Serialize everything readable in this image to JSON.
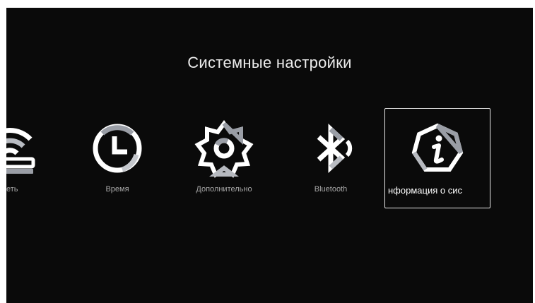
{
  "page": {
    "title": "Системные настройки"
  },
  "menu": {
    "items": [
      {
        "label": "еть",
        "icon": "wifi-router-icon"
      },
      {
        "label": "Время",
        "icon": "clock-icon"
      },
      {
        "label": "Дополнительно",
        "icon": "gear-icon"
      },
      {
        "label": "Bluetooth",
        "icon": "bluetooth-icon"
      },
      {
        "label": "нформация о сис",
        "icon": "info-icon",
        "focused": true
      }
    ]
  },
  "colors": {
    "background": "#0a0a0a",
    "icon_light": "#ffffff",
    "icon_shade": "#9a9ea6",
    "focus_border": "#e8e8e8"
  }
}
